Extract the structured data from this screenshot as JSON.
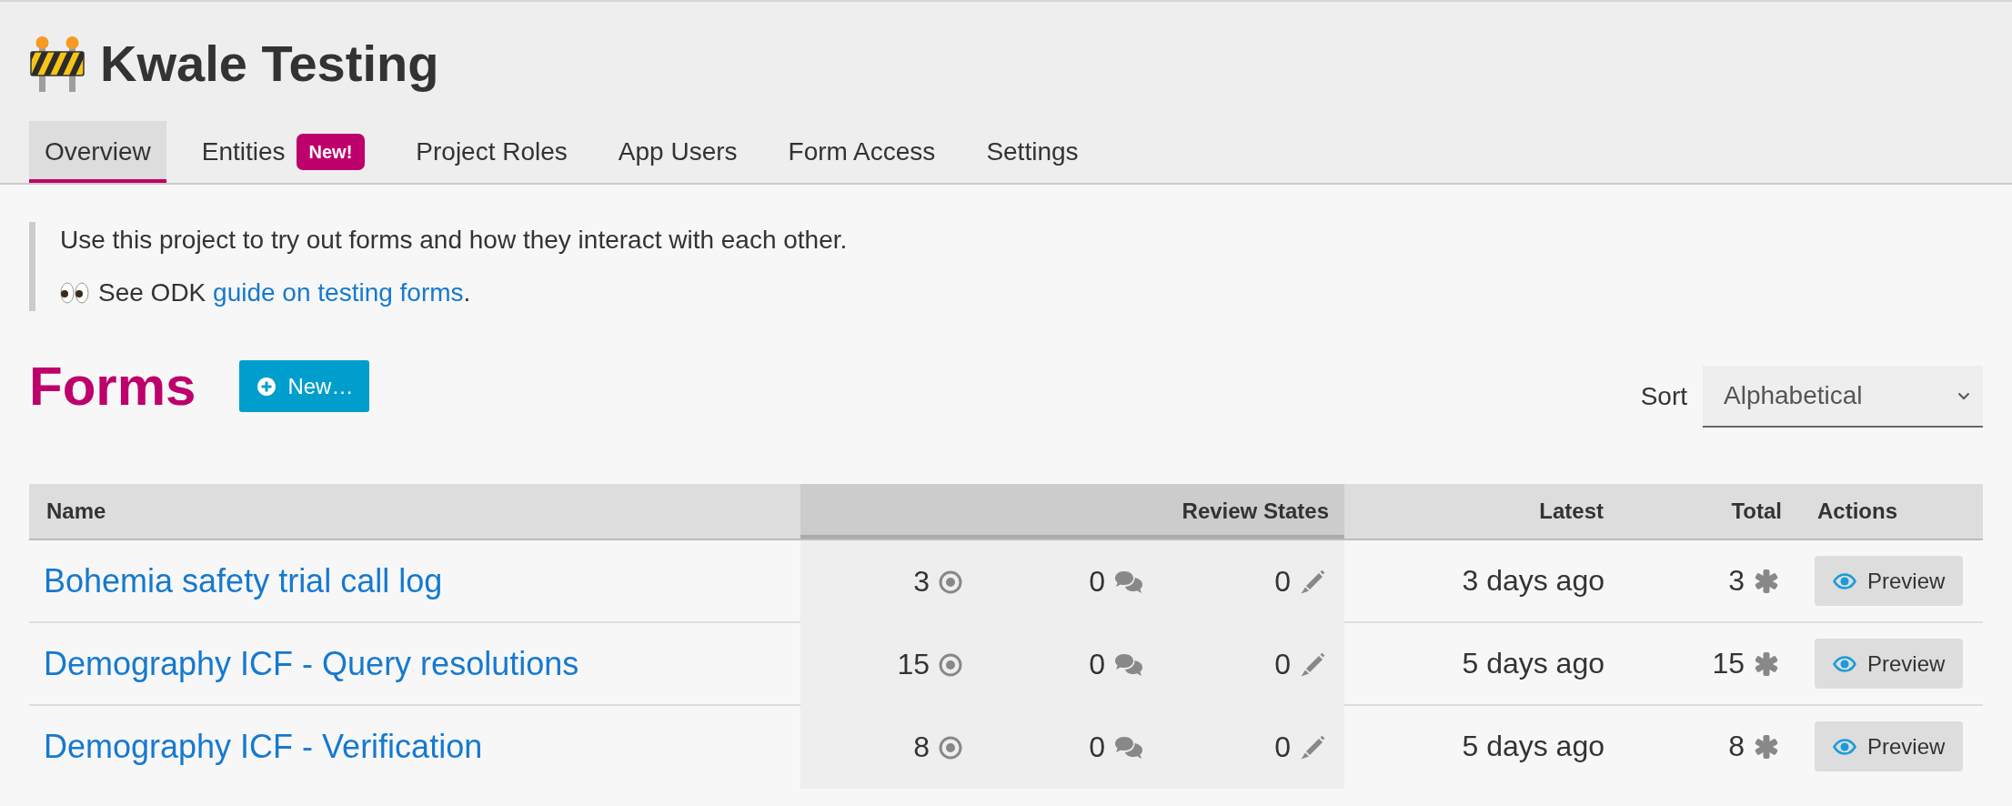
{
  "project": {
    "title": "Kwale Testing"
  },
  "tabs": [
    {
      "label": "Overview",
      "selected": true
    },
    {
      "label": "Entities",
      "selected": false,
      "badge": "New!"
    },
    {
      "label": "Project Roles",
      "selected": false
    },
    {
      "label": "App Users",
      "selected": false
    },
    {
      "label": "Form Access",
      "selected": false
    },
    {
      "label": "Settings",
      "selected": false
    }
  ],
  "description": {
    "text": "Use this project to try out forms and how they interact with each other.",
    "guide": {
      "prefix": "See ODK",
      "link": "guide on testing forms",
      "suffix": "."
    }
  },
  "forms": {
    "heading": "Forms",
    "new_button": "New…",
    "sort": {
      "label": "Sort",
      "value": "Alphabetical"
    }
  },
  "table": {
    "columns": [
      "Name",
      "Review States",
      "Latest",
      "Total",
      "Actions"
    ],
    "rows": [
      {
        "name": "Bohemia safety trial call log",
        "review_states": [
          {
            "kind": "received",
            "count": "3"
          },
          {
            "kind": "has_issues",
            "count": "0"
          },
          {
            "kind": "edited",
            "count": "0"
          }
        ],
        "latest": "3 days ago",
        "total": "3",
        "action": "Preview"
      },
      {
        "name": "Demography ICF - Query resolutions",
        "review_states": [
          {
            "kind": "received",
            "count": "15"
          },
          {
            "kind": "has_issues",
            "count": "0"
          },
          {
            "kind": "edited",
            "count": "0"
          }
        ],
        "latest": "5 days ago",
        "total": "15",
        "action": "Preview"
      },
      {
        "name": "Demography ICF - Verification",
        "review_states": [
          {
            "kind": "received",
            "count": "8"
          },
          {
            "kind": "has_issues",
            "count": "0"
          },
          {
            "kind": "edited",
            "count": "0"
          }
        ],
        "latest": "5 days ago",
        "total": "8",
        "action": "Preview"
      }
    ]
  }
}
